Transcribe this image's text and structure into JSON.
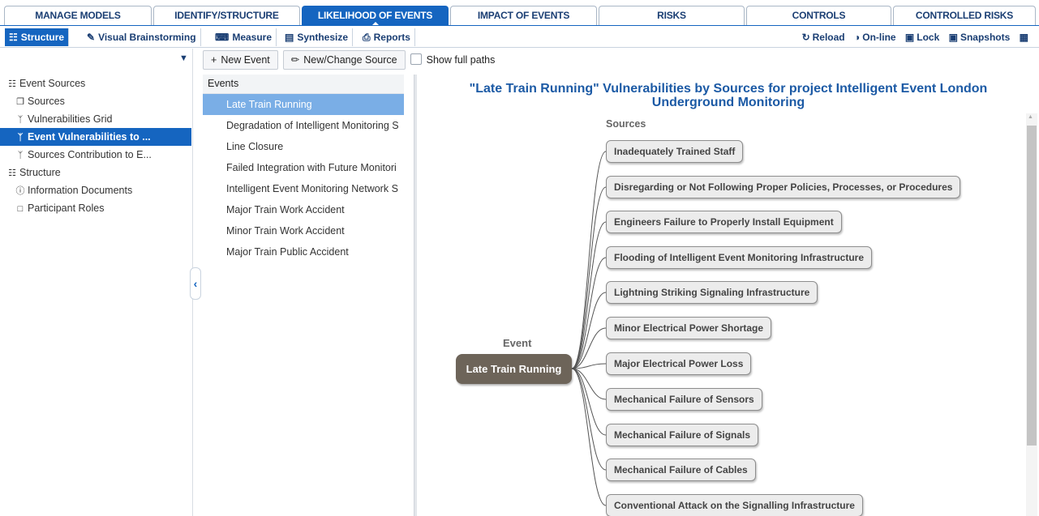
{
  "top_tabs": [
    {
      "label": "MANAGE MODELS",
      "active": false
    },
    {
      "label": "IDENTIFY/STRUCTURE",
      "active": false
    },
    {
      "label": "LIKELIHOOD OF EVENTS",
      "active": true
    },
    {
      "label": "IMPACT OF EVENTS",
      "active": false
    },
    {
      "label": "RISKS",
      "active": false
    },
    {
      "label": "CONTROLS",
      "active": false
    },
    {
      "label": "CONTROLLED RISKS",
      "active": false
    }
  ],
  "sub_tabs": [
    {
      "label": "Structure",
      "icon": "sitemap-icon",
      "active": true
    },
    {
      "label": "Visual Brainstorming",
      "icon": "edit-icon",
      "active": false
    },
    {
      "label": "Measure",
      "icon": "keyboard-icon",
      "active": false
    },
    {
      "label": "Synthesize",
      "icon": "bar-chart-icon",
      "active": false
    },
    {
      "label": "Reports",
      "icon": "print-icon",
      "active": false
    }
  ],
  "right_commands": [
    {
      "label": "Reload",
      "icon": "reload-icon"
    },
    {
      "label": "On-line",
      "icon": "toggle-icon"
    },
    {
      "label": "Lock",
      "icon": "lock-icon"
    },
    {
      "label": "Snapshots",
      "icon": "camera-icon"
    },
    {
      "label": "",
      "icon": "save-icon"
    }
  ],
  "tree": [
    {
      "label": "Event Sources",
      "level": 0,
      "icon": "sitemap-icon",
      "selected": false
    },
    {
      "label": "Sources",
      "level": 1,
      "icon": "copy-icon",
      "selected": false
    },
    {
      "label": "Vulnerabilities Grid",
      "level": 1,
      "icon": "branch-icon",
      "selected": false
    },
    {
      "label": "Event Vulnerabilities to ...",
      "level": 1,
      "icon": "branch-icon",
      "selected": true
    },
    {
      "label": "Sources Contribution to E...",
      "level": 1,
      "icon": "branch-icon",
      "selected": false
    },
    {
      "label": "Structure",
      "level": 0,
      "icon": "sitemap-icon",
      "selected": false
    },
    {
      "label": "Information Documents",
      "level": 1,
      "icon": "info-icon",
      "selected": false
    },
    {
      "label": "Participant Roles",
      "level": 1,
      "icon": "unlock-icon",
      "selected": false
    }
  ],
  "toolbar": {
    "new_event": "New Event",
    "new_change_source": "New/Change Source",
    "show_full_paths": "Show full paths"
  },
  "events": {
    "header": "Events",
    "items": [
      {
        "label": "Late Train Running",
        "selected": true
      },
      {
        "label": "Degradation of Intelligent Monitoring S",
        "selected": false
      },
      {
        "label": "Line Closure",
        "selected": false
      },
      {
        "label": "Failed Integration with Future Monitori",
        "selected": false
      },
      {
        "label": "Intelligent Event Monitoring Network S",
        "selected": false
      },
      {
        "label": "Major Train Work Accident",
        "selected": false
      },
      {
        "label": "Minor Train Work Accident",
        "selected": false
      },
      {
        "label": "Major Train Public Accident",
        "selected": false
      }
    ]
  },
  "diagram": {
    "title_line1": "\"Late Train Running\" Vulnerabilities by Sources for project Intelligent Event London",
    "title_line2": "Underground Monitoring",
    "sources_label": "Sources",
    "event_label": "Event",
    "event_name": "Late Train Running",
    "sources": [
      "Inadequately Trained Staff",
      "Disregarding or Not Following Proper Policies, Processes, or Procedures",
      "Engineers Failure to Properly Install Equipment",
      "Flooding of Intelligent Event Monitoring Infrastructure",
      "Lightning Striking Signaling Infrastructure",
      "Minor Electrical Power Shortage",
      "Major Electrical Power Loss",
      "Mechanical Failure of Sensors",
      "Mechanical Failure of Signals",
      "Mechanical Failure of Cables",
      "Conventional Attack on the Signalling Infrastructure"
    ]
  },
  "colors": {
    "brand_blue": "#1565c0",
    "selected_event": "#7aaee6",
    "event_node": "#6d6459"
  }
}
